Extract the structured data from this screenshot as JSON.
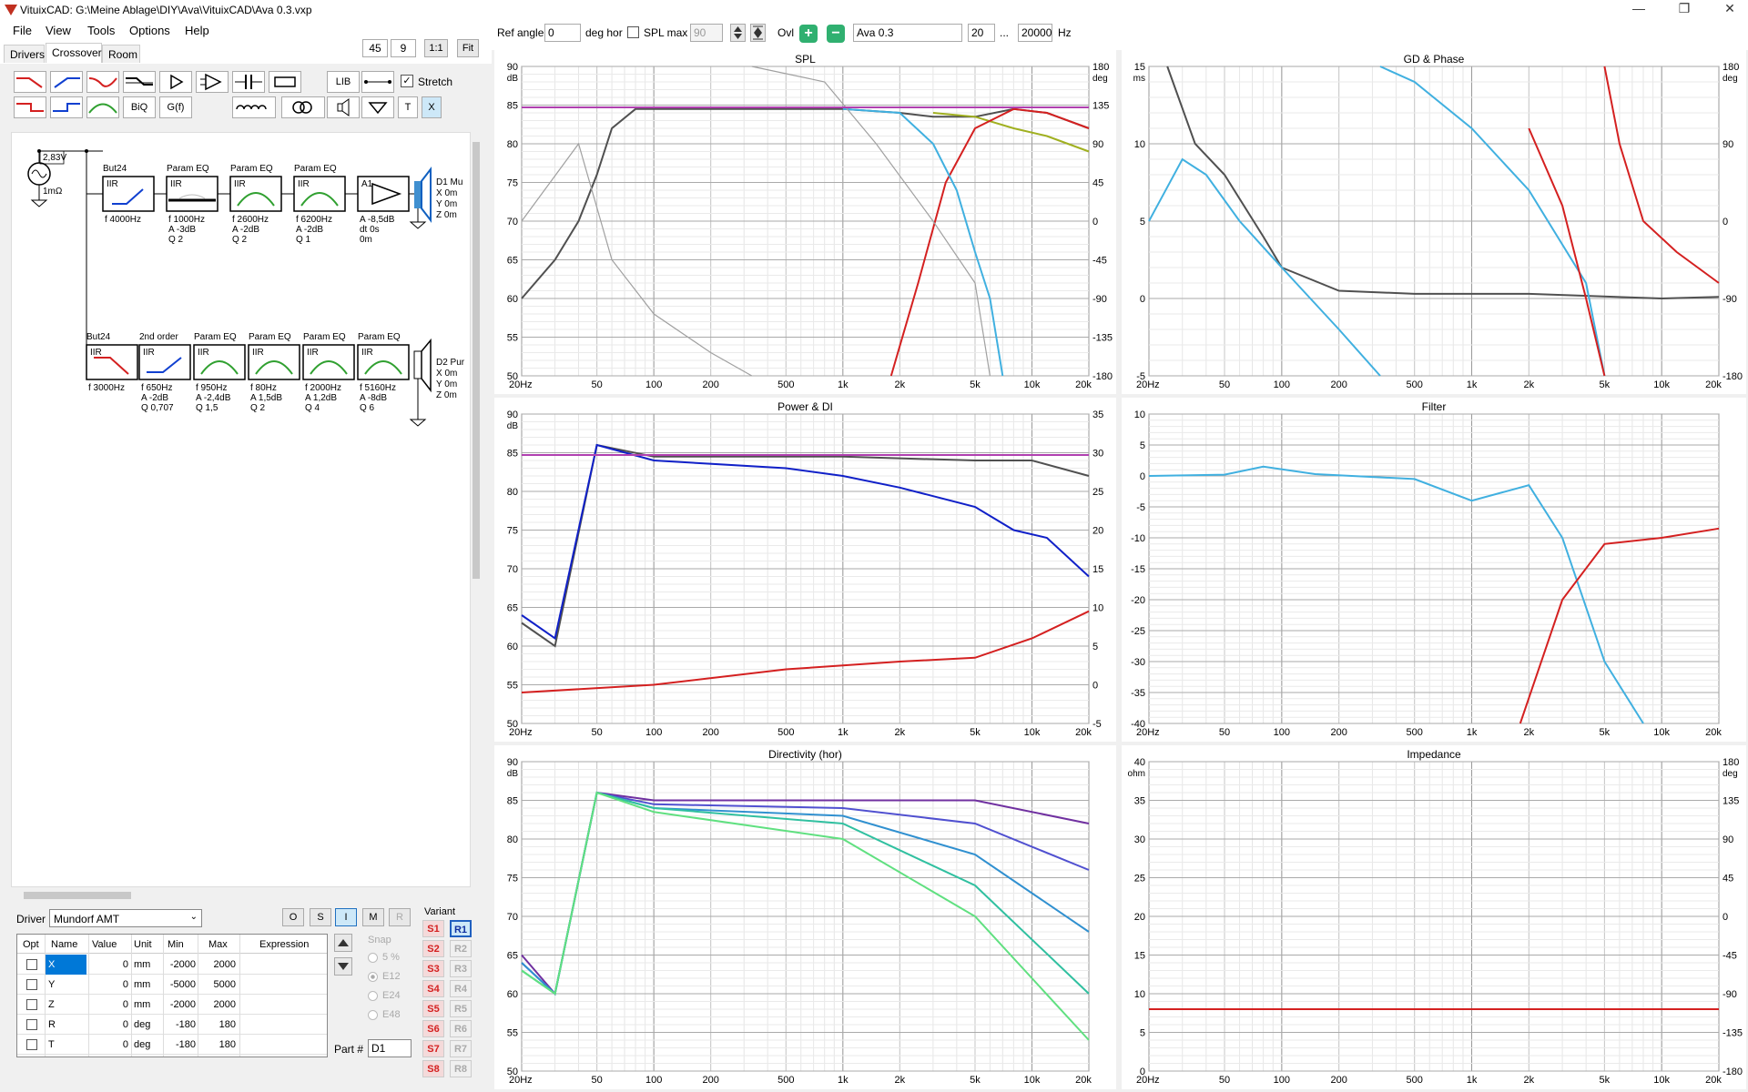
{
  "window": {
    "title": "VituixCAD: G:\\Meine Ablage\\DIY\\Ava\\VituixCAD\\Ava 0.3.vxp",
    "controls": {
      "minimize": "—",
      "maximize": "❐",
      "close": "✕"
    }
  },
  "menu": {
    "file": "File",
    "view": "View",
    "tools": "Tools",
    "options": "Options",
    "help": "Help"
  },
  "tabs": {
    "drivers": "Drivers",
    "crossover": "Crossover",
    "room": "Room"
  },
  "toolbar": {
    "grid_x": "45",
    "grid_y": "9",
    "scale": "1:1",
    "fit": "Fit",
    "lib": "LIB",
    "biq": "BiQ",
    "gf": "G(f)",
    "t": "T",
    "x": "X",
    "stretch": "Stretch"
  },
  "schematic": {
    "source": {
      "voltage": "2,83V",
      "impedance": "1mΩ"
    },
    "branch1": [
      {
        "title": "But24",
        "type": "IIR",
        "p1": "f  4000Hz",
        "p2": "",
        "p3": ""
      },
      {
        "title": "Param EQ",
        "type": "IIR",
        "p1": "f  1000Hz",
        "p2": "A  -3dB",
        "p3": "Q  2"
      },
      {
        "title": "Param EQ",
        "type": "IIR",
        "p1": "f  2600Hz",
        "p2": "A  -2dB",
        "p3": "Q  2"
      },
      {
        "title": "Param EQ",
        "type": "IIR",
        "p1": "f  6200Hz",
        "p2": "A  -2dB",
        "p3": "Q  1"
      },
      {
        "title": "",
        "type": "A1",
        "p1": "A  -8,5dB",
        "p2": "dt 0s",
        "p3": "     0m"
      }
    ],
    "driver1": {
      "name": "D1 Mu",
      "x": "X  0m",
      "y": "Y  0m",
      "z": "Z  0m"
    },
    "branch2": [
      {
        "title": "But24",
        "type": "IIR",
        "p1": "f  3000Hz",
        "p2": "",
        "p3": ""
      },
      {
        "title": "2nd order",
        "type": "IIR",
        "p1": "f  650Hz",
        "p2": "A  -2dB",
        "p3": "Q  0,707"
      },
      {
        "title": "Param EQ",
        "type": "IIR",
        "p1": "f  950Hz",
        "p2": "A  -2,4dB",
        "p3": "Q  1,5"
      },
      {
        "title": "Param EQ",
        "type": "IIR",
        "p1": "f  80Hz",
        "p2": "A  1,5dB",
        "p3": "Q  2"
      },
      {
        "title": "Param EQ",
        "type": "IIR",
        "p1": "f  2000Hz",
        "p2": "A  1,2dB",
        "p3": "Q  4"
      },
      {
        "title": "Param EQ",
        "type": "IIR",
        "p1": "f  5160Hz",
        "p2": "A  -8dB",
        "p3": "Q  6"
      }
    ],
    "driver2": {
      "name": "D2 Pur",
      "x": "X  0m",
      "y": "Y  0m",
      "z": "Z  0m"
    }
  },
  "driverpanel": {
    "label": "Driver",
    "selected": "Mundorf AMT",
    "o": "O",
    "s": "S",
    "i": "I",
    "m": "M",
    "r": "R",
    "variant": "Variant",
    "snap": "Snap",
    "snap_opts": [
      "5 %",
      "E12",
      "E24",
      "E48"
    ],
    "part_label": "Part #",
    "part_value": "D1",
    "columns": [
      "Opt",
      "Name",
      "Value",
      "Unit",
      "Min",
      "Max",
      "Expression"
    ],
    "rows": [
      {
        "name": "X",
        "value": "0",
        "unit": "mm",
        "min": "-2000",
        "max": "2000"
      },
      {
        "name": "Y",
        "value": "0",
        "unit": "mm",
        "min": "-5000",
        "max": "5000"
      },
      {
        "name": "Z",
        "value": "0",
        "unit": "mm",
        "min": "-2000",
        "max": "2000"
      },
      {
        "name": "R",
        "value": "0",
        "unit": "deg",
        "min": "-180",
        "max": "180"
      },
      {
        "name": "T",
        "value": "0",
        "unit": "deg",
        "min": "-180",
        "max": "180"
      }
    ],
    "svariants": [
      "S1",
      "S2",
      "S3",
      "S4",
      "S5",
      "S6",
      "S7",
      "S8"
    ],
    "rvariants": [
      "R1",
      "R2",
      "R3",
      "R4",
      "R5",
      "R6",
      "R7",
      "R8"
    ]
  },
  "graphbar": {
    "ref_angle_label": "Ref angle",
    "ref_angle": "0",
    "deg_hor": "deg hor",
    "spl_max": "SPL max",
    "spl_max_val": "90",
    "ovl": "Ovl",
    "overlay_name": "Ava 0.3",
    "f_min": "20",
    "dots": "...",
    "f_max": "20000",
    "hz": "Hz"
  },
  "colors": {
    "accent": "#1a7fd4",
    "red": "#d42020",
    "blue": "#1020c8",
    "cyan": "#40b0e0",
    "gray": "#505050",
    "lightgray": "#a0a0a0",
    "magenta": "#b040b0",
    "olive": "#a0b020",
    "green": "#30a030"
  },
  "freq_ticks": [
    "20Hz",
    "50",
    "100",
    "200",
    "500",
    "1k",
    "2k",
    "5k",
    "10k",
    "20k"
  ],
  "chart_data": [
    {
      "title": "SPL",
      "type": "line",
      "ylabel": "dB",
      "y2label": "deg",
      "ylim": [
        50,
        90
      ],
      "y2lim": [
        -180,
        180
      ],
      "yticks": [
        "90",
        "85",
        "80",
        "75",
        "70",
        "65",
        "60",
        "55",
        "50"
      ],
      "y2ticks": [
        "180",
        "135",
        "90",
        "45",
        "0",
        "-45",
        "-90",
        "-135",
        "-180"
      ],
      "series": [
        {
          "color": "gray",
          "points": [
            [
              20,
              60
            ],
            [
              30,
              65
            ],
            [
              40,
              70
            ],
            [
              50,
              76
            ],
            [
              60,
              82
            ],
            [
              80,
              84.5
            ],
            [
              100,
              84.5
            ],
            [
              200,
              84.5
            ],
            [
              500,
              84.5
            ],
            [
              1000,
              84.5
            ],
            [
              2000,
              84
            ],
            [
              3000,
              83.5
            ],
            [
              5000,
              83.5
            ],
            [
              8000,
              84.5
            ],
            [
              12000,
              84
            ],
            [
              20000,
              82
            ]
          ]
        },
        {
          "color": "olive",
          "points": [
            [
              3000,
              84
            ],
            [
              5000,
              83.5
            ],
            [
              8000,
              82
            ],
            [
              12000,
              81
            ],
            [
              20000,
              79
            ]
          ]
        },
        {
          "color": "red",
          "points": [
            [
              1800,
              50
            ],
            [
              2500,
              62
            ],
            [
              3500,
              75
            ],
            [
              5000,
              82
            ],
            [
              8000,
              84.5
            ],
            [
              12000,
              84
            ],
            [
              20000,
              82
            ]
          ]
        },
        {
          "color": "cyan",
          "points": [
            [
              1000,
              84.5
            ],
            [
              2000,
              84
            ],
            [
              3000,
              80
            ],
            [
              4000,
              74
            ],
            [
              5000,
              66
            ],
            [
              6000,
              60
            ],
            [
              7000,
              50
            ]
          ]
        },
        {
          "color": "lightgray",
          "points": [
            [
              20,
              70
            ],
            [
              40,
              80
            ],
            [
              60,
              65
            ],
            [
              100,
              58
            ],
            [
              200,
              53
            ],
            [
              330,
              50
            ]
          ]
        },
        {
          "color": "lightgray",
          "points": [
            [
              330,
              90
            ],
            [
              800,
              88
            ],
            [
              1500,
              80
            ],
            [
              3000,
              70
            ],
            [
              5000,
              62
            ],
            [
              6000,
              50
            ]
          ]
        },
        {
          "color": "magenta",
          "points": [
            [
              20,
              84.7
            ],
            [
              20000,
              84.7
            ]
          ]
        }
      ]
    },
    {
      "title": "GD & Phase",
      "type": "line",
      "ylabel": "ms",
      "y2label": "deg",
      "ylim": [
        -5,
        15
      ],
      "y2lim": [
        -180,
        180
      ],
      "yticks": [
        "15",
        "10",
        "5",
        "0",
        "-5"
      ],
      "y2ticks": [
        "180",
        "90",
        "0",
        "-90",
        "-180"
      ],
      "series": [
        {
          "color": "gray",
          "points": [
            [
              25,
              15
            ],
            [
              35,
              10
            ],
            [
              50,
              8
            ],
            [
              80,
              4
            ],
            [
              100,
              2
            ],
            [
              200,
              0.5
            ],
            [
              500,
              0.3
            ],
            [
              2000,
              0.3
            ],
            [
              10000,
              0
            ],
            [
              20000,
              0.1
            ]
          ]
        },
        {
          "color": "cyan",
          "points": [
            [
              20,
              5
            ],
            [
              30,
              9
            ],
            [
              40,
              8
            ],
            [
              60,
              5
            ],
            [
              100,
              2
            ],
            [
              200,
              -2
            ],
            [
              330,
              -5
            ]
          ]
        },
        {
          "color": "cyan",
          "points": [
            [
              330,
              15
            ],
            [
              500,
              14
            ],
            [
              1000,
              11
            ],
            [
              2000,
              7
            ],
            [
              4000,
              1
            ],
            [
              5000,
              -5
            ]
          ]
        },
        {
          "color": "red",
          "points": [
            [
              2000,
              11
            ],
            [
              3000,
              6
            ],
            [
              4000,
              0
            ],
            [
              5000,
              -5
            ]
          ]
        },
        {
          "color": "red",
          "points": [
            [
              5000,
              15
            ],
            [
              6000,
              10
            ],
            [
              8000,
              5
            ],
            [
              12000,
              3
            ],
            [
              20000,
              1
            ]
          ]
        }
      ]
    },
    {
      "title": "Power & DI",
      "type": "line",
      "ylabel": "dB",
      "y2label": "",
      "ylim": [
        50,
        90
      ],
      "y2lim": [
        -5,
        35
      ],
      "yticks": [
        "90",
        "85",
        "80",
        "75",
        "70",
        "65",
        "60",
        "55",
        "50"
      ],
      "y2ticks": [
        "35",
        "30",
        "25",
        "20",
        "15",
        "10",
        "5",
        "0",
        "-5"
      ],
      "series": [
        {
          "color": "gray",
          "points": [
            [
              20,
              63
            ],
            [
              30,
              60
            ],
            [
              50,
              86
            ],
            [
              100,
              84.5
            ],
            [
              1000,
              84.5
            ],
            [
              5000,
              84
            ],
            [
              10000,
              84
            ],
            [
              20000,
              82
            ]
          ]
        },
        {
          "color": "blue",
          "points": [
            [
              20,
              64
            ],
            [
              30,
              61
            ],
            [
              50,
              86
            ],
            [
              100,
              84
            ],
            [
              500,
              83
            ],
            [
              1000,
              82
            ],
            [
              2000,
              80.5
            ],
            [
              5000,
              78
            ],
            [
              8000,
              75
            ],
            [
              12000,
              74
            ],
            [
              20000,
              69
            ]
          ]
        },
        {
          "color": "red",
          "points": [
            [
              20,
              54
            ],
            [
              100,
              55
            ],
            [
              500,
              57
            ],
            [
              1000,
              57.5
            ],
            [
              2000,
              58
            ],
            [
              5000,
              58.5
            ],
            [
              10000,
              61
            ],
            [
              20000,
              64.5
            ]
          ]
        },
        {
          "color": "magenta",
          "points": [
            [
              20,
              84.7
            ],
            [
              20000,
              84.7
            ]
          ]
        }
      ]
    },
    {
      "title": "Filter",
      "type": "line",
      "ylabel": "",
      "y2label": "",
      "ylim": [
        -40,
        10
      ],
      "yticks": [
        "10",
        "5",
        "0",
        "-5",
        "-10",
        "-15",
        "-20",
        "-25",
        "-30",
        "-35",
        "-40"
      ],
      "series": [
        {
          "color": "cyan",
          "points": [
            [
              20,
              0
            ],
            [
              50,
              0.2
            ],
            [
              80,
              1.5
            ],
            [
              150,
              0.3
            ],
            [
              500,
              -0.5
            ],
            [
              1000,
              -4
            ],
            [
              2000,
              -1.5
            ],
            [
              3000,
              -10
            ],
            [
              5000,
              -30
            ],
            [
              8000,
              -40
            ]
          ]
        },
        {
          "color": "red",
          "points": [
            [
              1800,
              -40
            ],
            [
              3000,
              -20
            ],
            [
              5000,
              -11
            ],
            [
              10000,
              -10
            ],
            [
              20000,
              -8.5
            ]
          ]
        }
      ]
    },
    {
      "title": "Directivity (hor)",
      "type": "line",
      "ylabel": "dB",
      "y2label": "",
      "ylim": [
        50,
        90
      ],
      "yticks": [
        "90",
        "85",
        "80",
        "75",
        "70",
        "65",
        "60",
        "55",
        "50"
      ],
      "series": [
        {
          "color": "#7030a0",
          "points": [
            [
              20,
              65
            ],
            [
              30,
              60
            ],
            [
              50,
              86
            ],
            [
              100,
              85
            ],
            [
              1000,
              85
            ],
            [
              5000,
              85
            ],
            [
              20000,
              82
            ]
          ]
        },
        {
          "color": "#5050d0",
          "points": [
            [
              20,
              64
            ],
            [
              30,
              60
            ],
            [
              50,
              86
            ],
            [
              100,
              84.5
            ],
            [
              1000,
              84
            ],
            [
              5000,
              82
            ],
            [
              20000,
              76
            ]
          ]
        },
        {
          "color": "#3090d0",
          "points": [
            [
              20,
              64
            ],
            [
              30,
              60
            ],
            [
              50,
              86
            ],
            [
              100,
              84
            ],
            [
              1000,
              83
            ],
            [
              5000,
              78
            ],
            [
              20000,
              68
            ]
          ]
        },
        {
          "color": "#30c0a0",
          "points": [
            [
              20,
              63
            ],
            [
              30,
              60
            ],
            [
              50,
              86
            ],
            [
              100,
              84
            ],
            [
              1000,
              82
            ],
            [
              5000,
              74
            ],
            [
              20000,
              60
            ]
          ]
        },
        {
          "color": "#60e080",
          "points": [
            [
              20,
              63
            ],
            [
              30,
              60
            ],
            [
              50,
              86
            ],
            [
              100,
              83.5
            ],
            [
              1000,
              80
            ],
            [
              5000,
              70
            ],
            [
              20000,
              54
            ]
          ]
        }
      ]
    },
    {
      "title": "Impedance",
      "type": "line",
      "ylabel": "ohm",
      "y2label": "deg",
      "ylim": [
        0,
        40
      ],
      "y2lim": [
        -180,
        180
      ],
      "yticks": [
        "40",
        "35",
        "30",
        "25",
        "20",
        "15",
        "10",
        "5",
        "0"
      ],
      "y2ticks": [
        "180",
        "135",
        "90",
        "45",
        "0",
        "-45",
        "-90",
        "-135",
        "-180"
      ],
      "series": [
        {
          "color": "red",
          "points": [
            [
              20,
              8
            ],
            [
              20000,
              8
            ]
          ]
        }
      ]
    }
  ]
}
